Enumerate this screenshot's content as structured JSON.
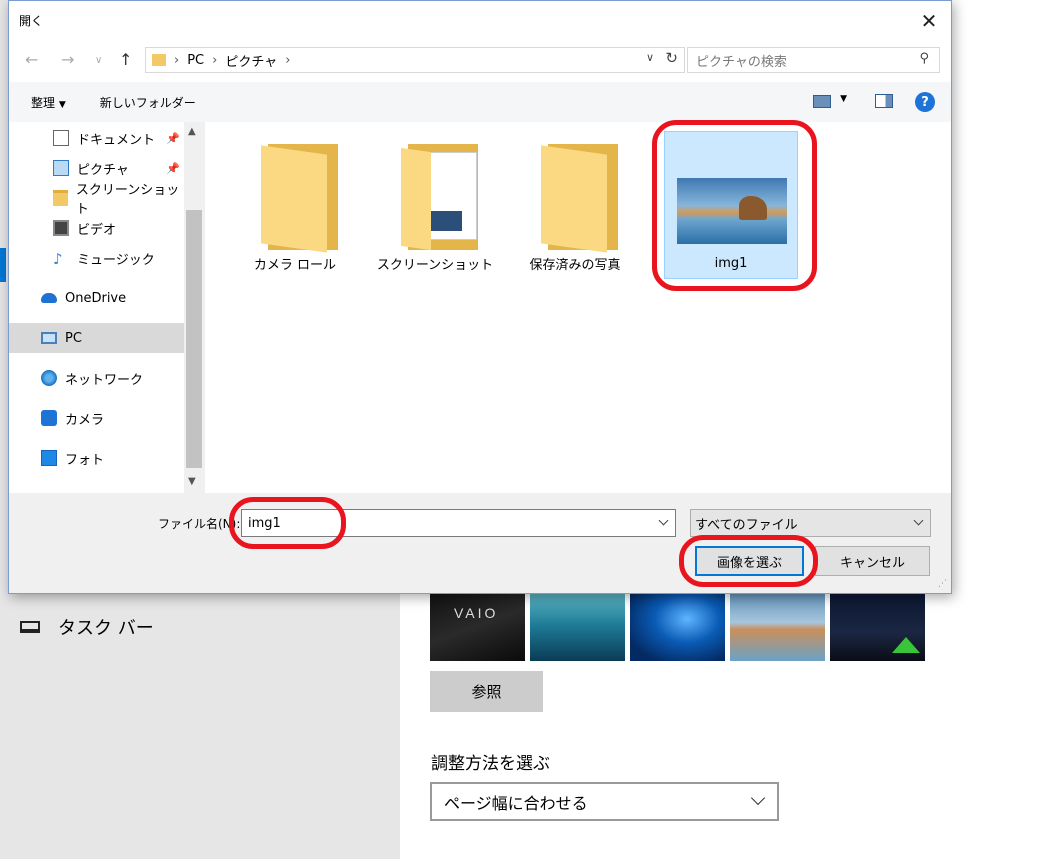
{
  "background": {
    "taskbar_label": "タスク バー",
    "thumb_vaio_text": "VAIO",
    "browse_label": "参照",
    "fit_label": "調整方法を選ぶ",
    "fit_value": "ページ幅に合わせる"
  },
  "dialog": {
    "title": "開く",
    "address": {
      "segments": [
        "PC",
        "ピクチャ"
      ]
    },
    "search_placeholder": "ピクチャの検索",
    "organize_label": "整理",
    "new_folder_label": "新しいフォルダー",
    "nav_items": [
      {
        "label": "ドキュメント",
        "icon": "document-icon",
        "pinned": true
      },
      {
        "label": "ピクチャ",
        "icon": "pictures-icon",
        "pinned": true
      },
      {
        "label": "スクリーンショット",
        "icon": "folder-icon",
        "pinned": false
      },
      {
        "label": "ビデオ",
        "icon": "video-icon",
        "pinned": false
      },
      {
        "label": "ミュージック",
        "icon": "music-icon",
        "pinned": false
      },
      {
        "label": "OneDrive",
        "icon": "onedrive-icon",
        "pinned": false
      },
      {
        "label": "PC",
        "icon": "pc-icon",
        "pinned": false,
        "selected": true
      },
      {
        "label": "ネットワーク",
        "icon": "network-icon",
        "pinned": false
      },
      {
        "label": "カメラ",
        "icon": "camera-icon",
        "pinned": false
      },
      {
        "label": "フォト",
        "icon": "photos-icon",
        "pinned": false
      }
    ],
    "files": [
      {
        "name": "カメラ ロール",
        "kind": "folder"
      },
      {
        "name": "スクリーンショット",
        "kind": "folder-with-preview"
      },
      {
        "name": "保存済みの写真",
        "kind": "folder"
      },
      {
        "name": "img1",
        "kind": "image",
        "selected": true
      }
    ],
    "filename_label": "ファイル名(N):",
    "filename_value": "img1",
    "filetype_value": "すべてのファイル",
    "open_label": "画像を選ぶ",
    "cancel_label": "キャンセル"
  },
  "colors": {
    "accent": "#0078d7",
    "annotation_red": "#e8141e",
    "selection": "#cce8ff"
  }
}
